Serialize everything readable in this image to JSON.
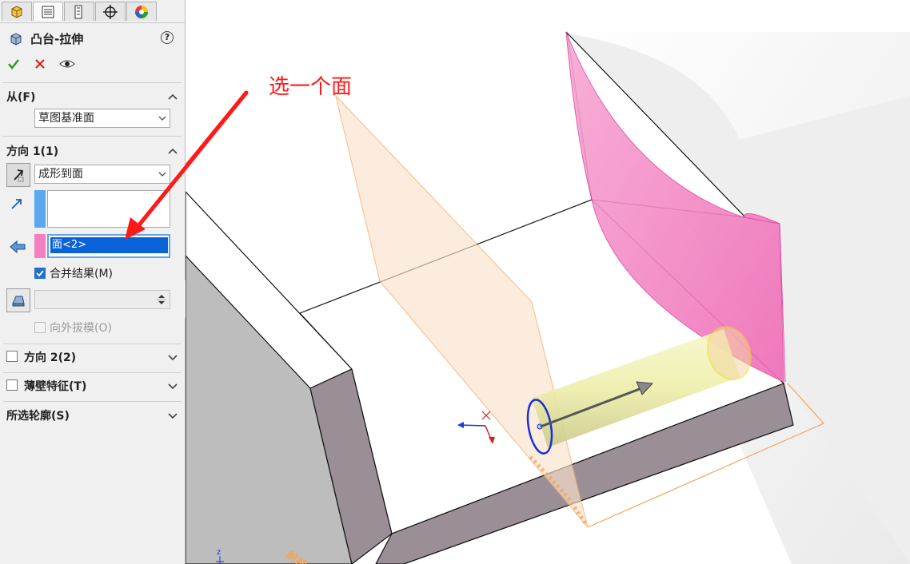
{
  "panel": {
    "tabs": [
      {
        "name": "featuremanager"
      },
      {
        "name": "propertymanager",
        "active": true
      },
      {
        "name": "configurationmanager"
      },
      {
        "name": "dimxpertmanager"
      },
      {
        "name": "displaymanager"
      }
    ],
    "title": "凸台-拉伸",
    "help": "?",
    "from": {
      "title": "从(F)",
      "value": "草图基准面"
    },
    "direction1": {
      "title": "方向 1(1)",
      "end_condition": "成形到面",
      "face_value": "面<2>",
      "merge_label": "合并结果(M)",
      "merge_checked": true,
      "draft_outward_label": "向外拔模(O)",
      "draft_outward_checked": false
    },
    "direction2": {
      "title": "方向 2(2)",
      "checked": false
    },
    "thin_feature": {
      "title": "薄壁特征(T)",
      "checked": false
    },
    "selected_contours": {
      "title": "所选轮廓(S)"
    }
  },
  "annotation": {
    "text": "选一个面",
    "color": "#ff1a1a"
  },
  "viewport": {
    "triad_label": "z",
    "plane_label": "前视"
  },
  "colors": {
    "accent": "#1f6fd1",
    "face_pink": "#f48fc8",
    "plane_orange": "#f2a55a",
    "cylinder_yellow": "#eef0a8"
  }
}
